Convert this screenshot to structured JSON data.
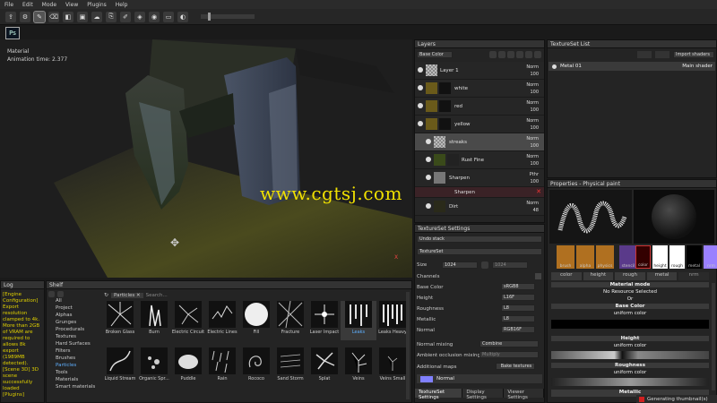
{
  "menu": [
    "File",
    "Edit",
    "Mode",
    "View",
    "Plugins",
    "Help"
  ],
  "toolbar": {
    "icons": [
      "share-icon",
      "settings-icon",
      "brush-icon",
      "eraser-icon",
      "projection-icon",
      "polygon-fill-icon",
      "smudge-icon",
      "clone-icon",
      "color-picker-icon",
      "geometry-mask-icon",
      "camera-icon",
      "screenshot-icon"
    ]
  },
  "ps_label": "Ps",
  "viewport": {
    "material": "Material",
    "anim": "Animation time: 2.377",
    "axis": "X"
  },
  "watermark": "www.cgtsj.com",
  "layers": {
    "title": "Layers",
    "channel": "Base Color",
    "rows": [
      {
        "name": "Layer 1",
        "blend": "Norm",
        "opacity": "100"
      },
      {
        "name": "white",
        "blend": "Norm",
        "opacity": "100"
      },
      {
        "name": "red",
        "blend": "Norm",
        "opacity": "100"
      },
      {
        "name": "yellow",
        "blend": "Norm",
        "opacity": "100"
      },
      {
        "name": "streaks",
        "blend": "Norm",
        "opacity": "100"
      },
      {
        "name": "Rust Fine",
        "blend": "Norm",
        "opacity": "100"
      },
      {
        "name": "Sharpen",
        "blend": "Pthr",
        "opacity": "100"
      },
      {
        "name": "Sharpen",
        "blend": "",
        "opacity": ""
      },
      {
        "name": "Dirt",
        "blend": "Norm",
        "opacity": "48"
      }
    ]
  },
  "tss": {
    "title": "TextureSet Settings",
    "undo": "Undo stack",
    "textureset": "TextureSet",
    "size_label": "Size",
    "size": "1024",
    "size2": "1024",
    "channels_label": "Channels",
    "channels": [
      {
        "name": "Base Color",
        "format": "sRGB8"
      },
      {
        "name": "Height",
        "format": "L16F"
      },
      {
        "name": "Roughness",
        "format": "L8"
      },
      {
        "name": "Metallic",
        "format": "L8"
      },
      {
        "name": "Normal",
        "format": "RGB16F"
      }
    ],
    "normal_mixing_label": "Normal mixing",
    "normal_mixing": "Combine",
    "ao_label": "Ambient occlusion mixing",
    "ao": "Multiply",
    "additional_label": "Additional maps",
    "bake_button": "Bake textures",
    "normal_bar": "Normal",
    "tabs": [
      "TextureSet Settings",
      "Display Settings",
      "Viewer Settings"
    ]
  },
  "tsl": {
    "title": "TextureSet List",
    "import": "Import shaders",
    "item": "Metal 01",
    "shader": "Main shader"
  },
  "props": {
    "title": "Properties - Physical paint",
    "chips": [
      "brush",
      "alpha",
      "physics",
      "stencil"
    ],
    "chips2": [
      "color",
      "height",
      "rough",
      "metal",
      "nrm"
    ],
    "channel_tabs": [
      "color",
      "height",
      "rough",
      "metal",
      "nrm"
    ],
    "material_mode": "Material mode",
    "no_resource": "No Resource Selected",
    "or": "Or",
    "base_color": "Base Color",
    "uniform": "uniform color",
    "height": "Height",
    "height_uniform": "uniform color",
    "roughness": "Roughness",
    "rough_uniform": "uniform color",
    "metallic": "Metallic"
  },
  "log": {
    "title": "Log",
    "text": "[Engine Configuration] Export resolution clamped to 4k. More than 2GB of VRAM are required to allows 8k export (1989MB detected). [Scene 3D] 3D scene successfully loaded [Plugins]"
  },
  "shelf": {
    "title": "Shelf",
    "filter": "Particles",
    "search_placeholder": "Search...",
    "categories": [
      "All",
      "Project",
      "Alphas",
      "Grunges",
      "Procedurals",
      "Textures",
      "Hard Surfaces",
      "Filters",
      "Brushes",
      "Particles",
      "Tools",
      "Materials",
      "Smart materials"
    ],
    "selected_category": "Particles",
    "items": [
      "Broken Glass",
      "Burn",
      "Electric Circuit",
      "Electric Lines",
      "Fill",
      "Fracture",
      "Laser Impact",
      "Leaks",
      "Leaks Heavy",
      "Liquid Stream",
      "Organic Spr...",
      "Puddle",
      "Rain",
      "Rococo",
      "Sand Storm",
      "Splat",
      "Veins",
      "Veins Small"
    ],
    "selected_item": "Leaks"
  },
  "status": "Generating thumbnail(s)",
  "colors": {
    "accent": "#5fb0ff",
    "watermark": "#f0e000",
    "log_text": "#e0d000",
    "status_red": "#d02020"
  }
}
